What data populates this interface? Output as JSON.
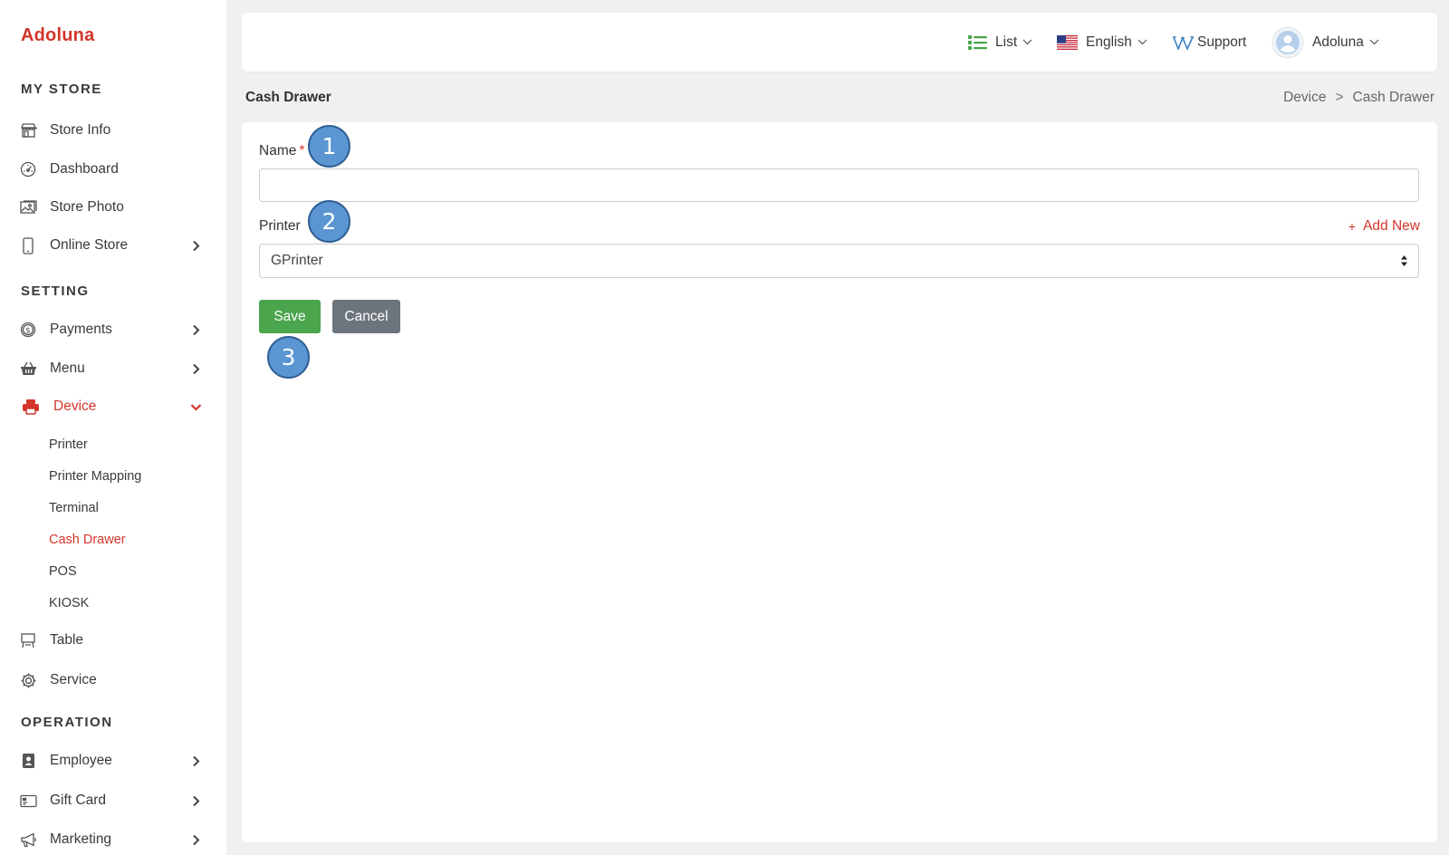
{
  "brand": "Adoluna",
  "sidebar": {
    "sections": [
      {
        "title": "MY STORE"
      },
      {
        "title": "SETTING"
      },
      {
        "title": "OPERATION"
      }
    ],
    "items": {
      "store_info": {
        "label": "Store Info",
        "icon": "storefront-icon"
      },
      "dashboard": {
        "label": "Dashboard",
        "icon": "gauge-icon"
      },
      "store_photo": {
        "label": "Store Photo",
        "icon": "photo-icon"
      },
      "online_store": {
        "label": "Online Store",
        "icon": "mobile-icon"
      },
      "payments": {
        "label": "Payments",
        "icon": "dollar-coin-icon"
      },
      "menu": {
        "label": "Menu",
        "icon": "basket-icon"
      },
      "device": {
        "label": "Device",
        "icon": "printer-icon",
        "expanded": true
      },
      "table": {
        "label": "Table",
        "icon": "table-icon"
      },
      "service": {
        "label": "Service",
        "icon": "gear-icon"
      },
      "employee": {
        "label": "Employee",
        "icon": "id-badge-icon"
      },
      "gift_card": {
        "label": "Gift Card",
        "icon": "card-icon"
      },
      "marketing": {
        "label": "Marketing",
        "icon": "megaphone-icon"
      }
    },
    "device_sub": [
      "Printer",
      "Printer Mapping",
      "Terminal",
      "Cash Drawer",
      "POS",
      "KIOSK"
    ],
    "active_sub": "Cash Drawer"
  },
  "topbar": {
    "list_label": "List",
    "language_label": "English",
    "support_label": "Support",
    "user_label": "Adoluna"
  },
  "page": {
    "title": "Cash Drawer",
    "breadcrumb": [
      "Device",
      ">",
      "Cash Drawer"
    ]
  },
  "form": {
    "name_label": "Name",
    "name_required": "*",
    "name_value": "",
    "printer_label": "Printer",
    "add_new_icon": "+",
    "add_new_label": "Add New",
    "printer_selected": "GPrinter",
    "save_label": "Save",
    "cancel_label": "Cancel"
  },
  "markers": [
    "1",
    "2",
    "3"
  ],
  "colors": {
    "accent": "#d3352b",
    "save": "#4aa54c",
    "cancel": "#6c757d",
    "marker": "#5b96d3"
  }
}
